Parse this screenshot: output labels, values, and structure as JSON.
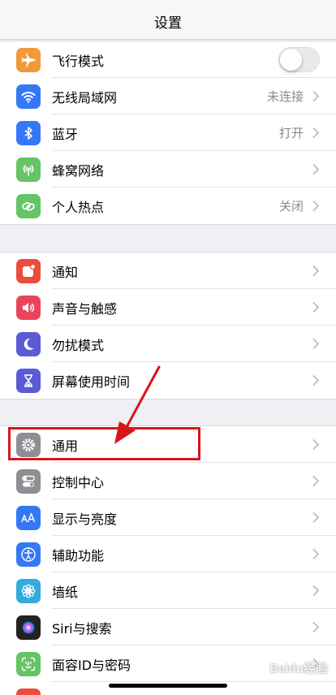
{
  "header": {
    "title": "设置"
  },
  "groups": [
    {
      "items": [
        {
          "key": "airplane",
          "label": "飞行模式",
          "icon": "airplane-icon",
          "color": "#f19a37",
          "toggle": false
        },
        {
          "key": "wifi",
          "label": "无线局域网",
          "value": "未连接",
          "icon": "wifi-icon",
          "color": "#3478f6"
        },
        {
          "key": "bluetooth",
          "label": "蓝牙",
          "value": "打开",
          "icon": "bluetooth-icon",
          "color": "#3478f6"
        },
        {
          "key": "cellular",
          "label": "蜂窝网络",
          "icon": "cellular-antenna-icon",
          "color": "#65c466"
        },
        {
          "key": "hotspot",
          "label": "个人热点",
          "value": "关闭",
          "icon": "hotspot-link-icon",
          "color": "#65c466"
        }
      ]
    },
    {
      "items": [
        {
          "key": "notifications",
          "label": "通知",
          "icon": "notification-icon",
          "color": "#eb4d3d"
        },
        {
          "key": "sounds",
          "label": "声音与触感",
          "icon": "speaker-icon",
          "color": "#eb445a"
        },
        {
          "key": "dnd",
          "label": "勿扰模式",
          "icon": "moon-icon",
          "color": "#5b5bd6"
        },
        {
          "key": "screentime",
          "label": "屏幕使用时间",
          "icon": "hourglass-icon",
          "color": "#5b5bd6"
        }
      ]
    },
    {
      "items": [
        {
          "key": "general",
          "label": "通用",
          "icon": "gear-icon",
          "color": "#8e8e93"
        },
        {
          "key": "control",
          "label": "控制中心",
          "icon": "switches-icon",
          "color": "#8e8e93"
        },
        {
          "key": "display",
          "label": "显示与亮度",
          "icon": "text-size-icon",
          "color": "#3478f6"
        },
        {
          "key": "accessibility",
          "label": "辅助功能",
          "icon": "accessibility-icon",
          "color": "#3478f6"
        },
        {
          "key": "wallpaper",
          "label": "墙纸",
          "icon": "flower-icon",
          "color": "#35aadc"
        },
        {
          "key": "siri",
          "label": "Siri与搜索",
          "icon": "siri-icon",
          "color": "#222222"
        },
        {
          "key": "faceid",
          "label": "面容ID与密码",
          "icon": "face-id-icon",
          "color": "#65c466"
        },
        {
          "key": "sos",
          "label": "",
          "icon": "sos-icon",
          "color": "#eb4d3d"
        }
      ]
    }
  ],
  "annotation": {
    "highlight_color": "#d9151b"
  },
  "watermark": "Baidu经验"
}
